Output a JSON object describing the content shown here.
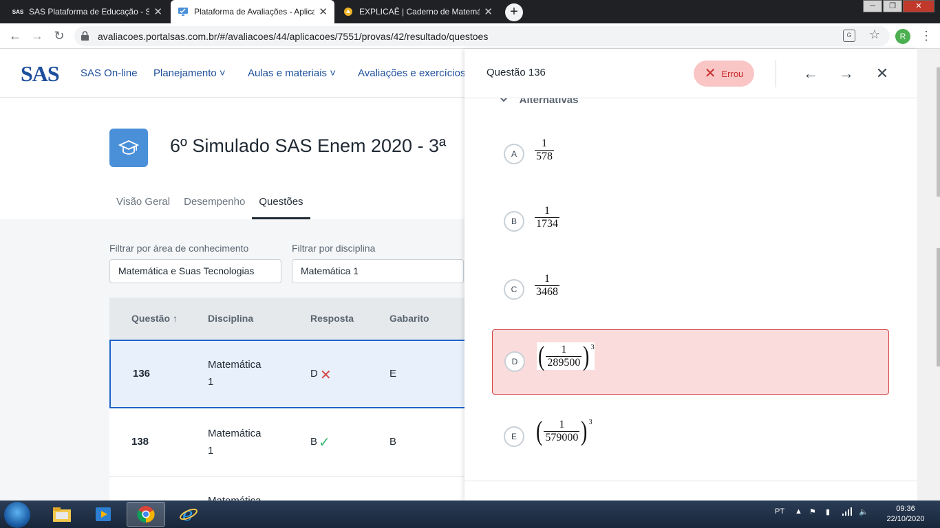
{
  "browser": {
    "tabs": [
      {
        "favicon": "SAS",
        "title": "SAS Plataforma de Educação - So",
        "close": "✕"
      },
      {
        "favicon": "monitor-icon",
        "title": "Plataforma de Avaliações - Aplica",
        "close": "✕"
      },
      {
        "favicon": "explicae-icon",
        "title": "EXPLICAÊ | Caderno de Matemáti",
        "close": "✕"
      }
    ],
    "new_tab": "+",
    "url": "avaliacoes.portalsas.com.br/#/avaliacoes/44/aplicacoes/7551/provas/42/resultado/questoes",
    "profile_initial": "R",
    "window_controls": {
      "minimize": "─",
      "maximize": "❐",
      "close": "✕"
    }
  },
  "site_nav": {
    "logo": "SAS",
    "items": [
      "SAS On-line",
      "Planejamento ˅",
      "Aulas e materiais ˅",
      "Avaliações e exercícios"
    ]
  },
  "exam": {
    "title": "6º Simulado SAS Enem 2020 - 3ª",
    "tabs": [
      "Visão Geral",
      "Desempenho",
      "Questões"
    ]
  },
  "filters": {
    "area_label": "Filtrar por área de conhecimento",
    "area_value": "Matemática e Suas Tecnologias",
    "discipline_label": "Filtrar por disciplina",
    "discipline_value": "Matemática 1"
  },
  "table": {
    "headers": [
      "Questão ↑",
      "Disciplina",
      "Resposta",
      "Gabarito"
    ],
    "rows": [
      {
        "question": "136",
        "discipline_1": "Matemática",
        "discipline_2": "1",
        "answer": "D",
        "answer_mark": "✕",
        "key": "E"
      },
      {
        "question": "138",
        "discipline_1": "Matemática",
        "discipline_2": "1",
        "answer": "B",
        "answer_mark": "✓",
        "key": "B"
      },
      {
        "question": "",
        "discipline_1": "Matemática",
        "discipline_2": "",
        "answer": "",
        "answer_mark": "",
        "key": ""
      }
    ]
  },
  "drawer": {
    "title": "Questão 136",
    "status": "Errou",
    "status_icon": "✕",
    "section": "Alternativas",
    "nav": {
      "prev": "←",
      "next": "→",
      "close": "✕"
    },
    "options": [
      {
        "letter": "A",
        "num": "1",
        "den": "578",
        "paren": false,
        "exp": ""
      },
      {
        "letter": "B",
        "num": "1",
        "den": "1734",
        "paren": false,
        "exp": ""
      },
      {
        "letter": "C",
        "num": "1",
        "den": "3468",
        "paren": false,
        "exp": ""
      },
      {
        "letter": "D",
        "num": "1",
        "den": "289500",
        "paren": true,
        "exp": "3"
      },
      {
        "letter": "E",
        "num": "1",
        "den": "579000",
        "paren": true,
        "exp": "3"
      }
    ],
    "open_paren": "(",
    "close_paren": ")"
  },
  "taskbar": {
    "lang": "PT",
    "time": "09:36",
    "date": "22/10/2020"
  },
  "colors": {
    "brand_blue": "#1e4f9c",
    "error_red": "#d64545",
    "error_bg": "#fadcdc",
    "success_green": "#2eb872"
  }
}
